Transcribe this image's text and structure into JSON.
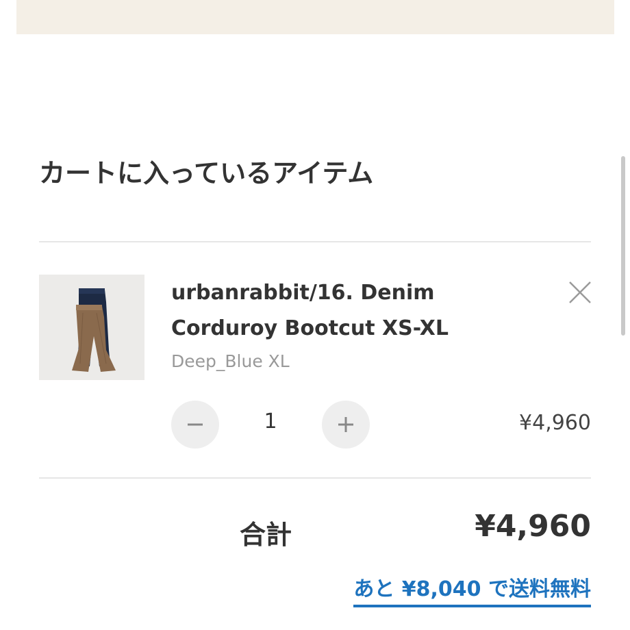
{
  "cart": {
    "title": "カートに入っているアイテム",
    "item": {
      "name": "urbanrabbit/16. Denim Corduroy Bootcut XS-XL",
      "variant": "Deep_Blue XL",
      "quantity": "1",
      "price": "¥4,960",
      "thumbnail_icon": "pants-product-photo",
      "remove_icon": "close-icon"
    },
    "summary": {
      "total_label": "合計",
      "total_value": "¥4,960",
      "free_shipping_note": "あと ¥8,040 で送料無料"
    }
  },
  "colors": {
    "banner": "#f4efe6",
    "link": "#1e73be",
    "text": "#333333",
    "muted": "#999999"
  }
}
